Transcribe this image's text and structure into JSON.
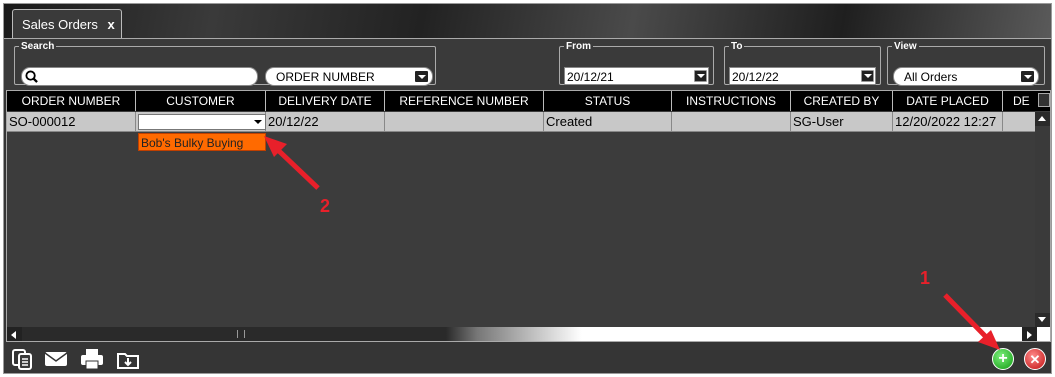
{
  "window": {
    "tab_label": "Sales Orders",
    "tab_close": "x"
  },
  "filters": {
    "search_legend": "Search",
    "search_value": "",
    "search_field": "ORDER NUMBER",
    "from_legend": "From",
    "from_value": "20/12/21",
    "to_legend": "To",
    "to_value": "20/12/22",
    "view_legend": "View",
    "view_value": "All Orders"
  },
  "grid": {
    "columns": [
      "ORDER NUMBER",
      "CUSTOMER",
      "DELIVERY DATE",
      "REFERENCE NUMBER",
      "STATUS",
      "INSTRUCTIONS",
      "CREATED BY",
      "DATE PLACED",
      "DE"
    ],
    "row": {
      "order_number": "SO-000012",
      "customer": "",
      "delivery_date": "20/12/22",
      "reference_number": "",
      "status": "Created",
      "instructions": "",
      "created_by": "SG-User",
      "date_placed": "12/20/2022 12:27"
    },
    "customer_option": "Bob's Bulky Buying"
  },
  "toolbar": {
    "add_label": "+",
    "cancel_label": "✕"
  },
  "annotations": {
    "one": "1",
    "two": "2"
  },
  "colors": {
    "accent_orange": "#ff6a00",
    "arrow_red": "#e8202a",
    "add_green": "#119a11",
    "cancel_red": "#c01010"
  }
}
